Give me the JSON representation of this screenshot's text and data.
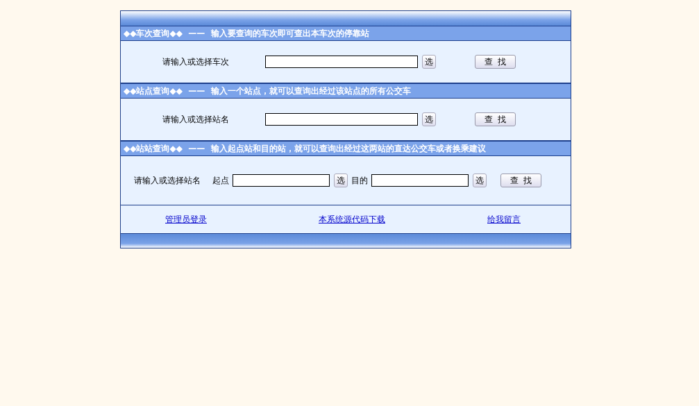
{
  "sections": [
    {
      "kind": "single",
      "header": "◆◆车次查询◆◆  ——  输入要查询的车次即可查出本车次的停靠站",
      "label": "请输入或选择车次",
      "pick": "选",
      "search": "查  找"
    },
    {
      "kind": "single",
      "header": "◆◆站点查询◆◆  ——  输入一个站点，就可以查询出经过该站点的所有公交车",
      "label": "请输入或选择站名",
      "pick": "选",
      "search": "查  找"
    },
    {
      "kind": "pair",
      "header": "◆◆站站查询◆◆  ——  输入起点站和目的站，就可以查询出经过这两站的直达公交车或者换乘建议",
      "label": "请输入或选择站名",
      "from_label": "起点",
      "to_label": "目的",
      "pick": "选",
      "pick_to": "选",
      "search": "查  找"
    }
  ],
  "links": [
    "管理员登录",
    "本系统源代码下载",
    "给我留言"
  ]
}
